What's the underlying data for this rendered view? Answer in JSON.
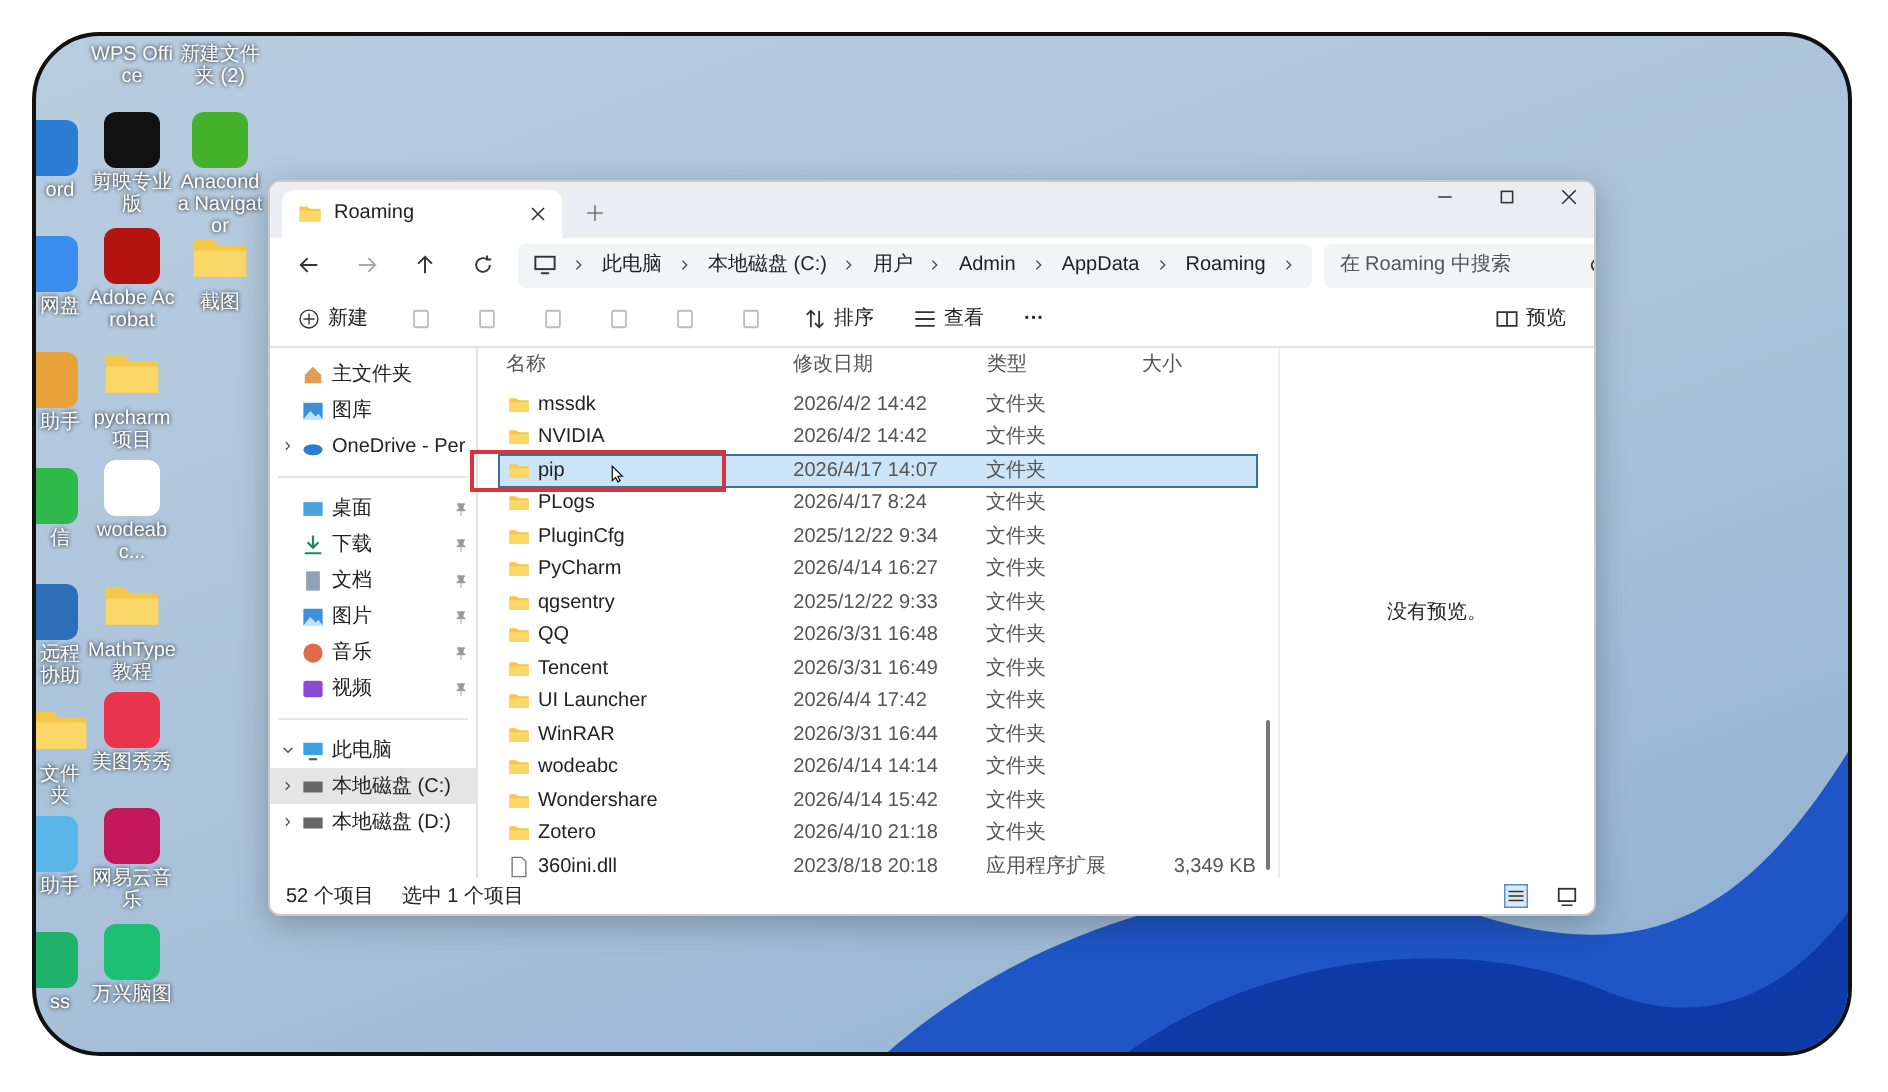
{
  "desktop": {
    "columns": [
      [
        {
          "label": "ord",
          "kind": "app",
          "color": "#2b7cd3"
        },
        {
          "label": "网盘",
          "kind": "app",
          "color": "#3a8ef0"
        },
        {
          "label": "助手",
          "kind": "app",
          "color": "#e8a23a"
        },
        {
          "label": "信",
          "kind": "app",
          "color": "#2fb94a"
        },
        {
          "label": "远程协助",
          "kind": "app",
          "color": "#2c6fb8"
        },
        {
          "label": "文件夹",
          "kind": "folder"
        },
        {
          "label": "助手",
          "kind": "app",
          "color": "#5ab6e8"
        },
        {
          "label": "ss",
          "kind": "app",
          "color": "#1fb36b"
        }
      ],
      [
        {
          "label": "WPS Office",
          "kind": "label"
        },
        {
          "label": "剪映专业版",
          "kind": "app",
          "color": "#111111"
        },
        {
          "label": "Adobe Acrobat",
          "kind": "app",
          "color": "#b3140f"
        },
        {
          "label": "pycharm项目",
          "kind": "folder"
        },
        {
          "label": "wodeabc...",
          "kind": "app",
          "color": "#ffffff"
        },
        {
          "label": "MathType教程",
          "kind": "folder"
        },
        {
          "label": "美图秀秀",
          "kind": "app",
          "color": "#e8344d"
        },
        {
          "label": "网易云音乐",
          "kind": "app",
          "color": "#c2185b"
        },
        {
          "label": "万兴脑图",
          "kind": "app",
          "color": "#1dbf73"
        }
      ],
      [
        {
          "label": "新建文件夹 (2)",
          "kind": "label"
        },
        {
          "label": "Anaconda Navigator",
          "kind": "app",
          "color": "#43b02a"
        },
        {
          "label": "截图",
          "kind": "folder"
        }
      ]
    ]
  },
  "window": {
    "tab": "Roaming",
    "breadcrumb": [
      "此电脑",
      "本地磁盘 (C:)",
      "用户",
      "Admin",
      "AppData",
      "Roaming"
    ],
    "search": {
      "placeholder": "在 Roaming 中搜索"
    },
    "toolbar": {
      "new": "新建",
      "sort": "排序",
      "view": "查看",
      "more": "···",
      "preview": "预览"
    },
    "nav": [
      {
        "label": "主文件夹",
        "kind": "home",
        "pinned": false,
        "selected": false
      },
      {
        "label": "图库",
        "kind": "gallery",
        "pinned": false,
        "selected": false
      },
      {
        "label": "OneDrive - Per",
        "kind": "cloud",
        "pinned": false,
        "selected": false
      },
      {
        "kind": "divider"
      },
      {
        "label": "桌面",
        "kind": "desktop",
        "pinned": true,
        "selected": false
      },
      {
        "label": "下载",
        "kind": "download",
        "pinned": true,
        "selected": false
      },
      {
        "label": "文档",
        "kind": "doc",
        "pinned": true,
        "selected": false
      },
      {
        "label": "图片",
        "kind": "gallery",
        "pinned": true,
        "selected": false
      },
      {
        "label": "音乐",
        "kind": "music",
        "pinned": true,
        "selected": false
      },
      {
        "label": "视频",
        "kind": "video",
        "pinned": true,
        "selected": false
      },
      {
        "kind": "divider"
      },
      {
        "label": "此电脑",
        "kind": "pc",
        "pinned": false,
        "selected": false,
        "expanded": true
      },
      {
        "label": "本地磁盘 (C:)",
        "kind": "drive",
        "pinned": false,
        "selected": true,
        "expanded": false
      },
      {
        "label": "本地磁盘 (D:)",
        "kind": "drive",
        "pinned": false,
        "selected": false,
        "expanded": false
      }
    ],
    "columns": [
      "名称",
      "修改日期",
      "类型",
      "大小"
    ],
    "files": [
      {
        "name": "mssdk",
        "date": "2026/4/2 14:42",
        "type": "文件夹",
        "kind": "folder",
        "selected": false
      },
      {
        "name": "NVIDIA",
        "date": "2026/4/2 14:42",
        "type": "文件夹",
        "kind": "folder",
        "selected": false
      },
      {
        "name": "pip",
        "date": "2026/4/17 14:07",
        "type": "文件夹",
        "kind": "folder",
        "selected": true
      },
      {
        "name": "PLogs",
        "date": "2026/4/17 8:24",
        "type": "文件夹",
        "kind": "folder",
        "selected": false
      },
      {
        "name": "PluginCfg",
        "date": "2025/12/22 9:34",
        "type": "文件夹",
        "kind": "folder",
        "selected": false
      },
      {
        "name": "PyCharm",
        "date": "2026/4/14 16:27",
        "type": "文件夹",
        "kind": "folder",
        "selected": false
      },
      {
        "name": "qgsentry",
        "date": "2025/12/22 9:33",
        "type": "文件夹",
        "kind": "folder",
        "selected": false
      },
      {
        "name": "QQ",
        "date": "2026/3/31 16:48",
        "type": "文件夹",
        "kind": "folder",
        "selected": false
      },
      {
        "name": "Tencent",
        "date": "2026/3/31 16:49",
        "type": "文件夹",
        "kind": "folder",
        "selected": false
      },
      {
        "name": "UI Launcher",
        "date": "2026/4/4 17:42",
        "type": "文件夹",
        "kind": "folder",
        "selected": false
      },
      {
        "name": "WinRAR",
        "date": "2026/3/31 16:44",
        "type": "文件夹",
        "kind": "folder",
        "selected": false
      },
      {
        "name": "wodeabc",
        "date": "2026/4/14 14:14",
        "type": "文件夹",
        "kind": "folder",
        "selected": false
      },
      {
        "name": "Wondershare",
        "date": "2026/4/14 15:42",
        "type": "文件夹",
        "kind": "folder",
        "selected": false
      },
      {
        "name": "Zotero",
        "date": "2026/4/10 21:18",
        "type": "文件夹",
        "kind": "folder",
        "selected": false
      },
      {
        "name": "360ini.dll",
        "date": "2023/8/18 20:18",
        "type": "应用程序扩展",
        "size": "3,349 KB",
        "kind": "file",
        "selected": false
      }
    ],
    "preview_message": "没有预览。",
    "status": {
      "count": "52 个项目",
      "selection": "选中 1 个项目"
    }
  }
}
